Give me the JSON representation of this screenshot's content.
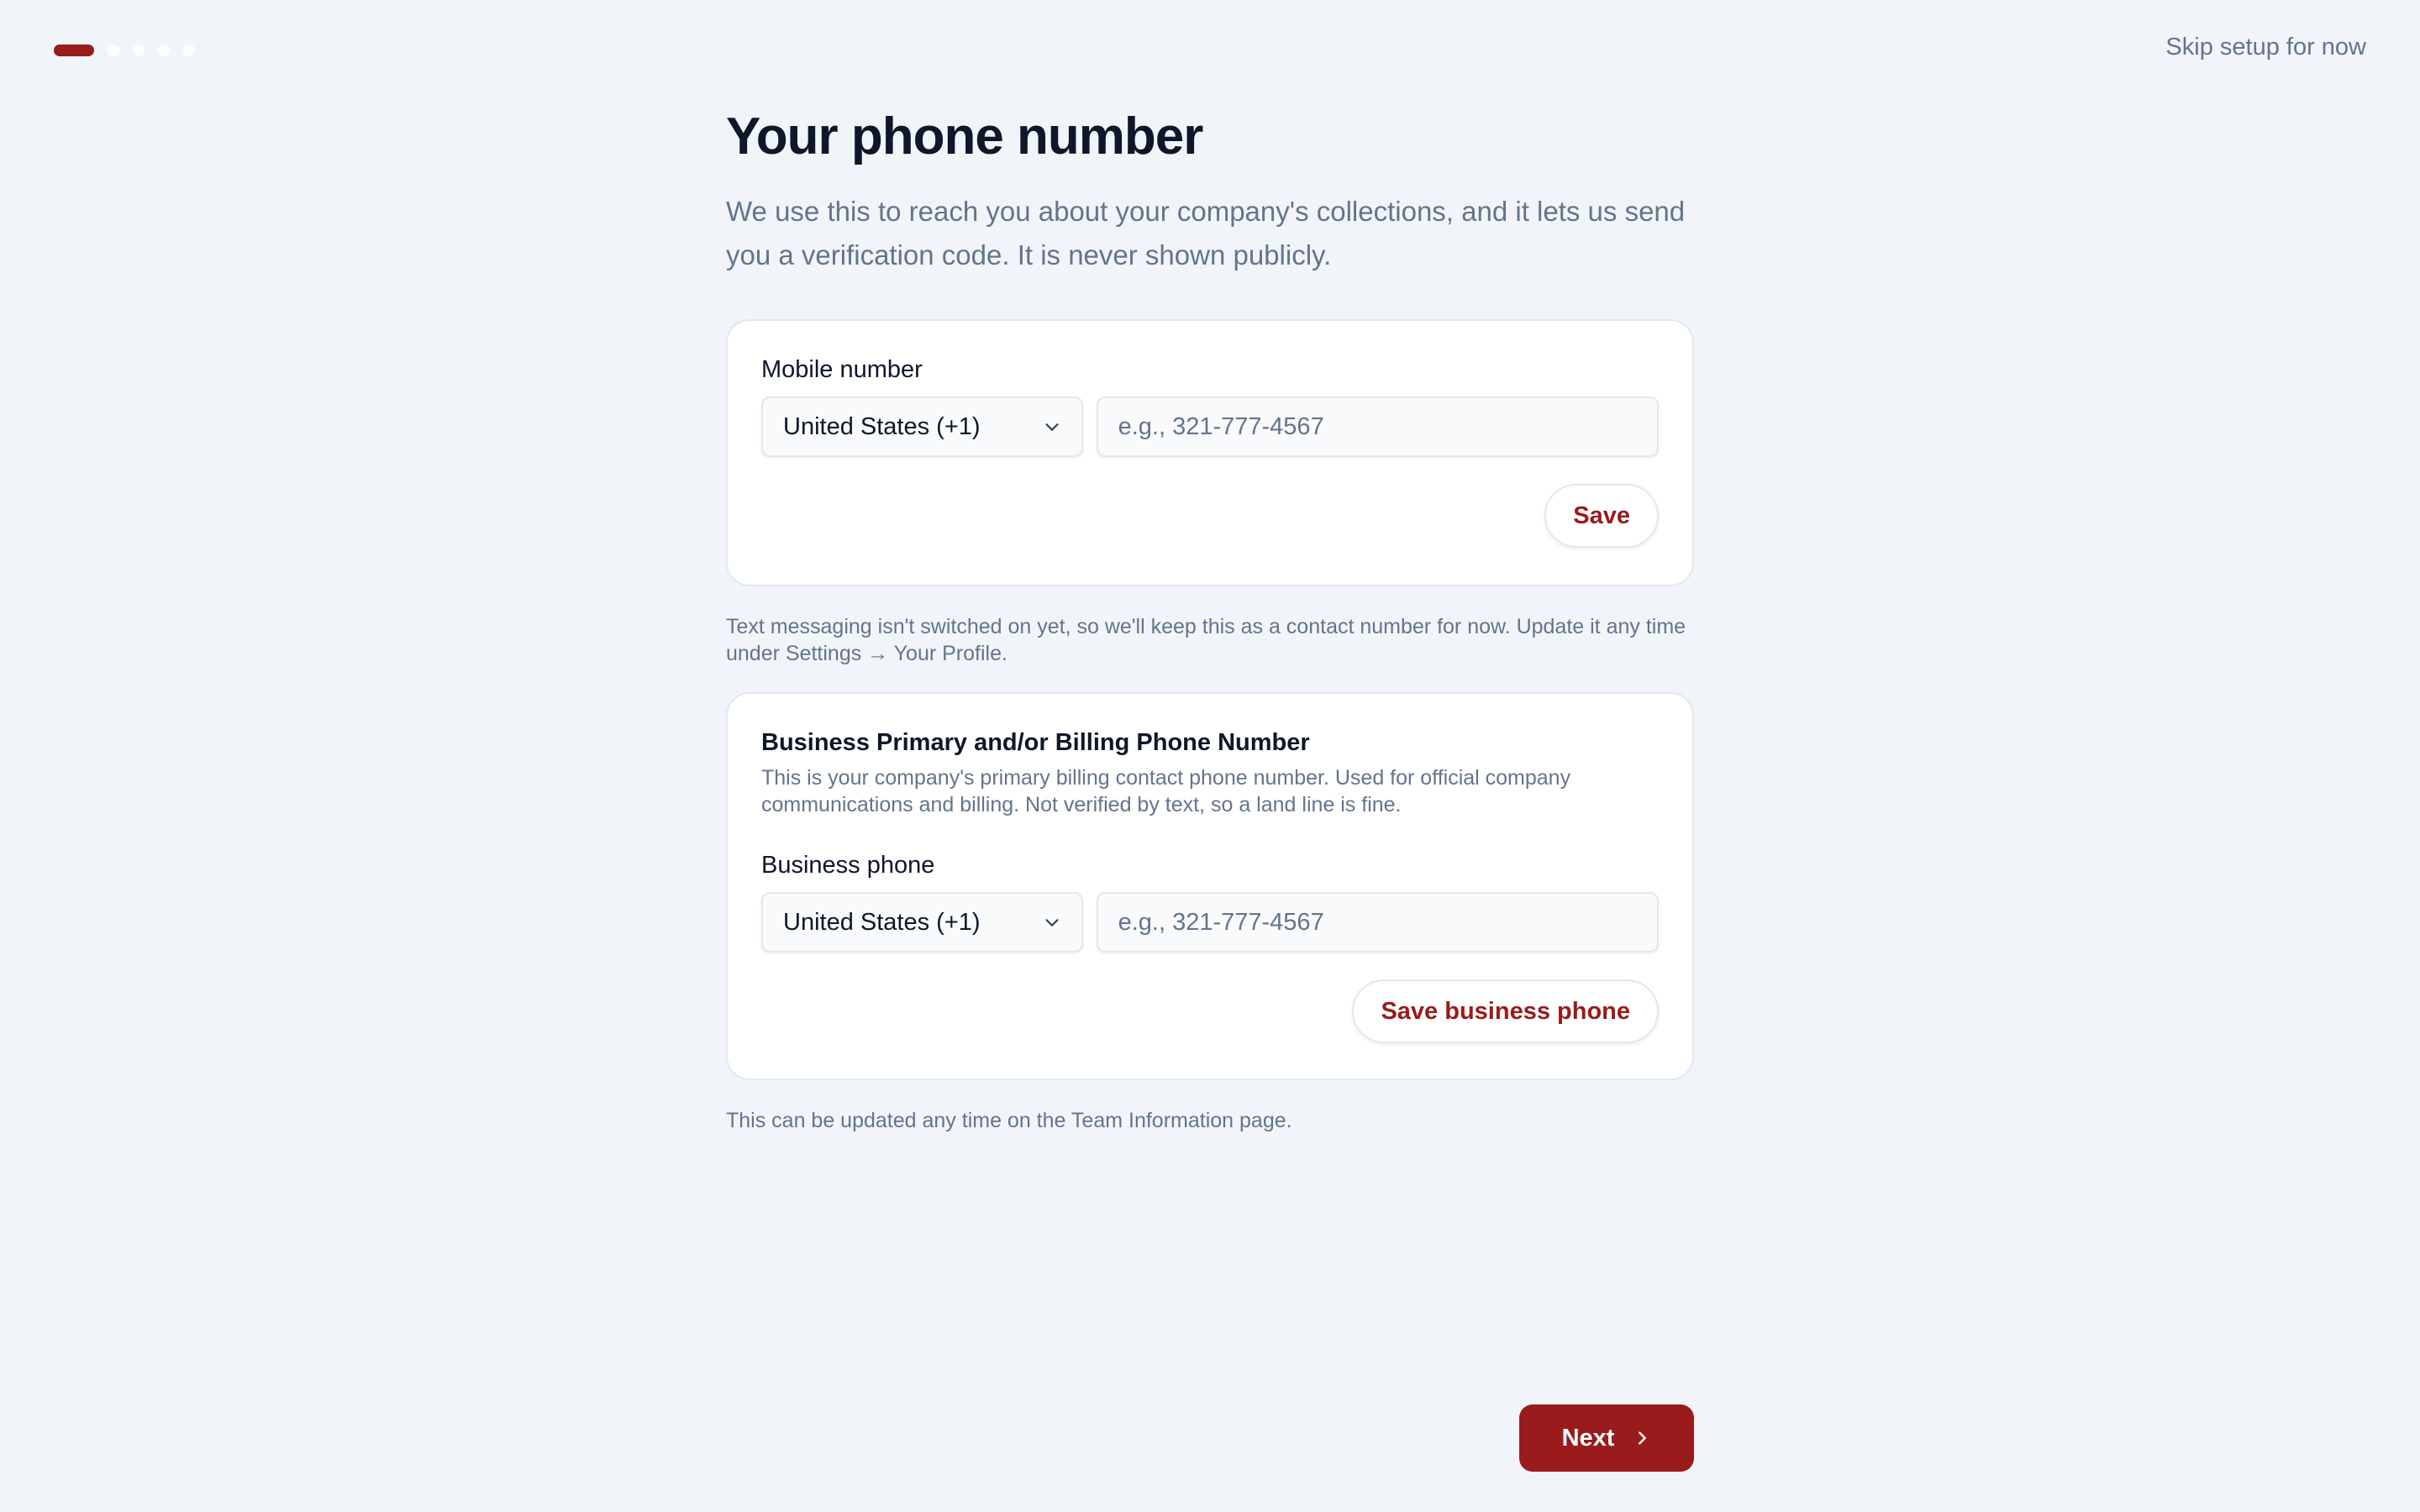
{
  "header": {
    "progress": {
      "total_steps": 5,
      "current_step": 1
    },
    "skip_label": "Skip setup for now"
  },
  "page": {
    "title": "Your phone number",
    "subtitle": "We use this to reach you about your company's collections, and it lets us send you a verification code. It is never shown publicly."
  },
  "mobile_card": {
    "label": "Mobile number",
    "country_select": "United States (+1)",
    "phone_placeholder": "e.g., 321-777-4567",
    "phone_value": "",
    "save_label": "Save"
  },
  "mobile_note": "Text messaging isn't switched on yet, so we'll keep this as a contact number for now. Update it any time under Settings → Your Profile.",
  "business_card": {
    "section_title": "Business Primary and/or Billing Phone Number",
    "section_desc": "This is your company's primary billing contact phone number. Used for official company communications and billing. Not verified by text, so a land line is fine.",
    "label": "Business phone",
    "country_select": "United States (+1)",
    "phone_placeholder": "e.g., 321-777-4567",
    "phone_value": "",
    "save_label": "Save business phone"
  },
  "business_note": "This can be updated any time on the Team Information page.",
  "footer": {
    "next_label": "Next"
  },
  "colors": {
    "accent": "#991b1b",
    "background": "#f1f5f9",
    "muted_text": "#64748b"
  },
  "icons": {
    "select_chevron": "chevron-down-icon",
    "next_chevron": "chevron-right-icon"
  }
}
